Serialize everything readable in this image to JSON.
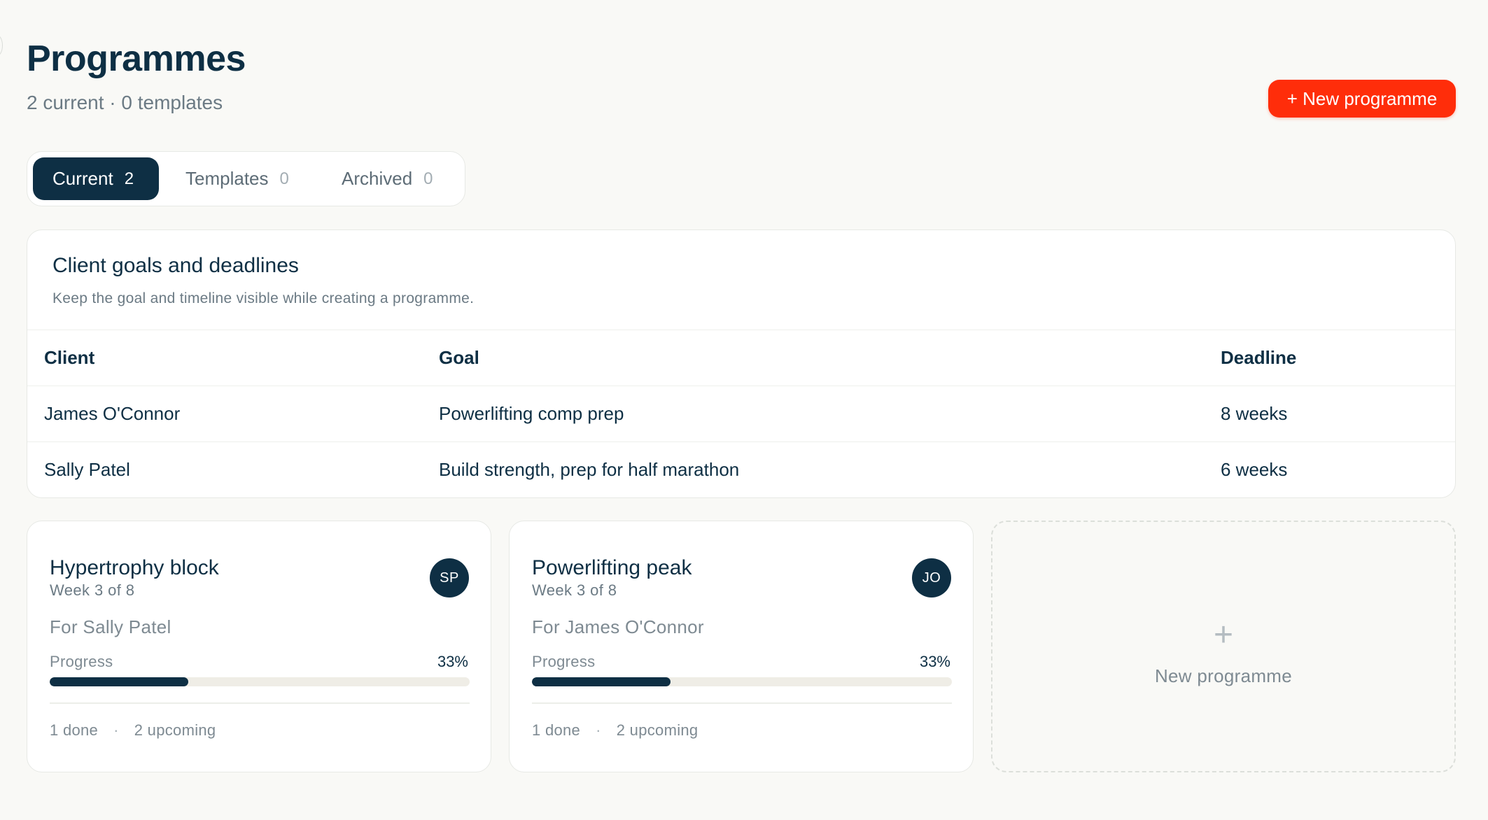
{
  "header": {
    "title": "Programmes",
    "subtitle": "2 current · 0 templates",
    "new_button_label": "+ New programme",
    "accent_color": "#ff2d0a",
    "primary_color": "#0e2f44"
  },
  "tabs": [
    {
      "label": "Current",
      "count": "2",
      "active": true
    },
    {
      "label": "Templates",
      "count": "0",
      "active": false
    },
    {
      "label": "Archived",
      "count": "0",
      "active": false
    }
  ],
  "goals": {
    "title": "Client goals and deadlines",
    "description": "Keep the goal and timeline visible while creating a programme.",
    "columns": [
      "Client",
      "Goal",
      "Deadline"
    ],
    "rows": [
      {
        "client": "James O'Connor",
        "goal": "Powerlifting comp prep",
        "deadline": "8 weeks"
      },
      {
        "client": "Sally Patel",
        "goal": "Build strength, prep for half marathon",
        "deadline": "6 weeks"
      }
    ]
  },
  "programmes": [
    {
      "name": "Hypertrophy block",
      "week": "Week 3 of 8",
      "initials": "SP",
      "client": "For Sally Patel",
      "progress_label": "Progress",
      "progress_text": "33%",
      "progress": 0.33,
      "done": "1 done",
      "upcoming": "2 upcoming"
    },
    {
      "name": "Powerlifting peak",
      "week": "Week 3 of 8",
      "initials": "JO",
      "client": "For James O'Connor",
      "progress_label": "Progress",
      "progress_text": "33%",
      "progress": 0.33,
      "done": "1 done",
      "upcoming": "2 upcoming"
    }
  ],
  "new_card": {
    "icon": "plus-icon",
    "plus": "+",
    "label": "New programme"
  }
}
